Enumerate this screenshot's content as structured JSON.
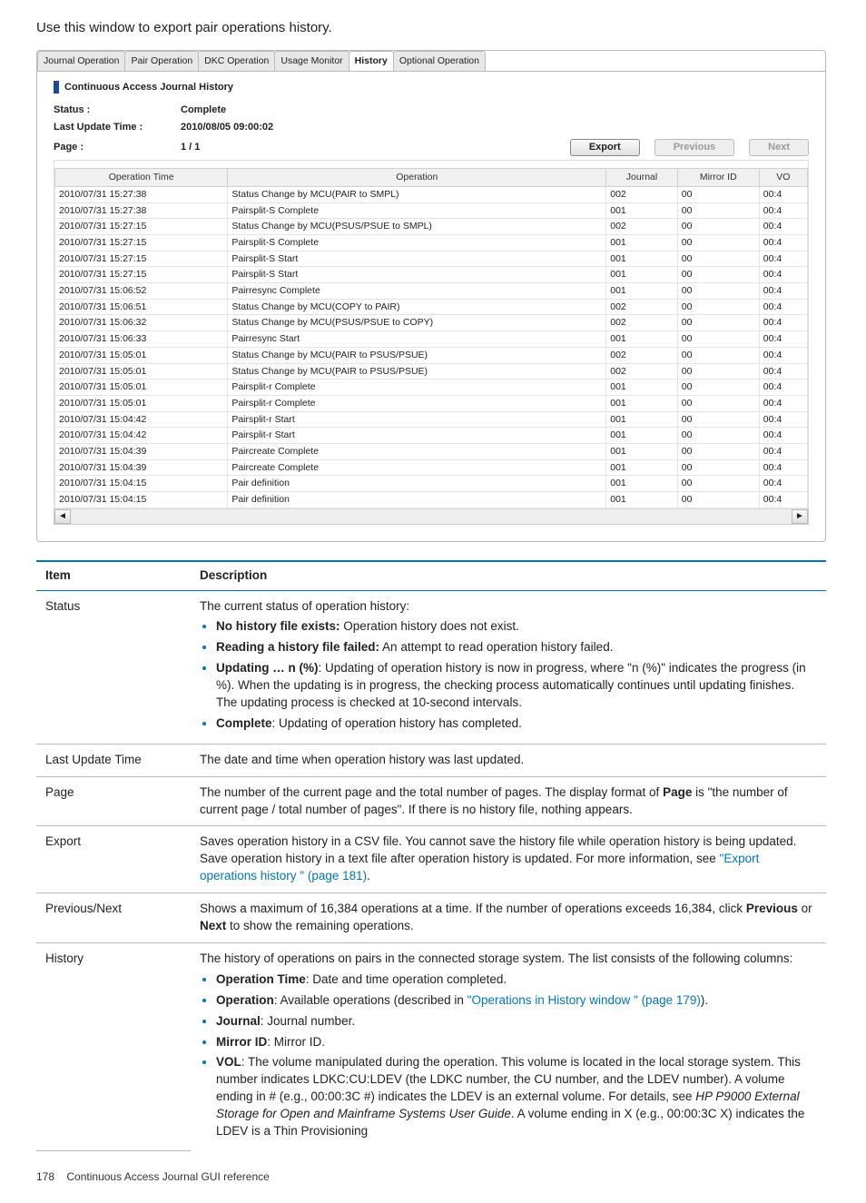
{
  "intro": "Use this window to export pair operations history.",
  "tabs": [
    "Journal Operation",
    "Pair Operation",
    "DKC Operation",
    "Usage Monitor",
    "History",
    "Optional Operation"
  ],
  "active_tab": 4,
  "panel_title": "Continuous Access Journal History",
  "meta": {
    "status_k": "Status :",
    "status_v": "Complete",
    "lut_k": "Last Update Time :",
    "lut_v": "2010/08/05 09:00:02",
    "page_k": "Page :",
    "page_v": "1 / 1"
  },
  "buttons": {
    "export": "Export",
    "prev": "Previous",
    "next": "Next"
  },
  "grid_headers": [
    "Operation Time",
    "Operation",
    "Journal",
    "Mirror ID",
    "VO"
  ],
  "grid_rows": [
    [
      "2010/07/31 15:27:38",
      "Status Change by MCU(PAIR to SMPL)",
      "002",
      "00",
      "00:4"
    ],
    [
      "2010/07/31 15:27:38",
      "Pairsplit-S Complete",
      "001",
      "00",
      "00:4"
    ],
    [
      "2010/07/31 15:27:15",
      "Status Change by MCU(PSUS/PSUE to SMPL)",
      "002",
      "00",
      "00:4"
    ],
    [
      "2010/07/31 15:27:15",
      "Pairsplit-S Complete",
      "001",
      "00",
      "00:4"
    ],
    [
      "2010/07/31 15:27:15",
      "Pairsplit-S Start",
      "001",
      "00",
      "00:4"
    ],
    [
      "2010/07/31 15:27:15",
      "Pairsplit-S Start",
      "001",
      "00",
      "00:4"
    ],
    [
      "2010/07/31 15:06:52",
      "Pairresync Complete",
      "001",
      "00",
      "00:4"
    ],
    [
      "2010/07/31 15:06:51",
      "Status Change by MCU(COPY to PAIR)",
      "002",
      "00",
      "00:4"
    ],
    [
      "2010/07/31 15:06:32",
      "Status Change by MCU(PSUS/PSUE to COPY)",
      "002",
      "00",
      "00:4"
    ],
    [
      "2010/07/31 15:06:33",
      "Pairresync Start",
      "001",
      "00",
      "00:4"
    ],
    [
      "2010/07/31 15:05:01",
      "Status Change by MCU(PAIR to PSUS/PSUE)",
      "002",
      "00",
      "00:4"
    ],
    [
      "2010/07/31 15:05:01",
      "Status Change by MCU(PAIR to PSUS/PSUE)",
      "002",
      "00",
      "00:4"
    ],
    [
      "2010/07/31 15:05:01",
      "Pairsplit-r Complete",
      "001",
      "00",
      "00:4"
    ],
    [
      "2010/07/31 15:05:01",
      "Pairsplit-r Complete",
      "001",
      "00",
      "00:4"
    ],
    [
      "2010/07/31 15:04:42",
      "Pairsplit-r Start",
      "001",
      "00",
      "00:4"
    ],
    [
      "2010/07/31 15:04:42",
      "Pairsplit-r Start",
      "001",
      "00",
      "00:4"
    ],
    [
      "2010/07/31 15:04:39",
      "Paircreate Complete",
      "001",
      "00",
      "00:4"
    ],
    [
      "2010/07/31 15:04:39",
      "Paircreate Complete",
      "001",
      "00",
      "00:4"
    ],
    [
      "2010/07/31 15:04:15",
      "Pair definition",
      "001",
      "00",
      "00:4"
    ],
    [
      "2010/07/31 15:04:15",
      "Pair definition",
      "001",
      "00",
      "00:4"
    ]
  ],
  "desc_headers": {
    "item": "Item",
    "desc": "Description"
  },
  "desc": {
    "status": {
      "k": "Status",
      "lead": "The current status of operation history:",
      "b1k": "No history file exists:",
      "b1v": " Operation history does not exist.",
      "b2k": "Reading a history file failed:",
      "b2v": " An attempt to read operation history failed.",
      "b3k": "Updating … n (%)",
      "b3v": ": Updating of operation history is now in progress, where \"n (%)\" indicates the progress (in %). When the updating is in progress, the checking process automatically continues until updating finishes. The updating process is checked at 10-second intervals.",
      "b4k": "Complete",
      "b4v": ": Updating of operation history has completed."
    },
    "lut": {
      "k": "Last Update Time",
      "v": "The date and time when operation history was last updated."
    },
    "page": {
      "k": "Page",
      "v1": "The number of the current page and the total number of pages. The display format of ",
      "vb": "Page",
      "v2": " is \"the number of current page / total number of pages\". If there is no history file, nothing appears."
    },
    "export": {
      "k": "Export",
      "v1": "Saves operation history in a CSV file. You cannot save the history file while operation history is being updated. Save operation history in a text file after operation history is updated. For more information, see ",
      "link": "\"Export operations history \" (page 181)",
      "v2": "."
    },
    "pn": {
      "k": "Previous/Next",
      "v1": "Shows a maximum of 16,384 operations at a time. If the number of operations exceeds 16,384, click ",
      "b1": "Previous",
      "mid": " or ",
      "b2": "Next",
      "v2": " to show the remaining operations."
    },
    "history": {
      "k": "History",
      "lead": "The history of operations on pairs in the connected storage system. The list consists of the following columns:",
      "ot_k": "Operation Time",
      "ot_v": ": Date and time operation completed.",
      "op_k": "Operation",
      "op_v": ": Available operations (described in ",
      "op_link": "\"Operations in History window \" (page 179)",
      "op_v2": ").",
      "jr_k": "Journal",
      "jr_v": ": Journal number.",
      "mi_k": "Mirror ID",
      "mi_v": ": Mirror ID.",
      "vol_k": "VOL",
      "vol_v1": ": The volume manipulated during the operation. This volume is located in the local storage system. This number indicates LDKC:CU:LDEV (the LDKC number, the CU number, and the LDEV number). A volume ending in # (e.g., 00:00:3C #) indicates the LDEV is an external volume. For details, see ",
      "vol_i": "HP P9000 External Storage for Open and Mainframe Systems User Guide",
      "vol_v2": ". A volume ending in X (e.g., 00:00:3C X) indicates the LDEV is a Thin Provisioning"
    }
  },
  "footer": {
    "page": "178",
    "title": "Continuous Access Journal GUI reference"
  }
}
